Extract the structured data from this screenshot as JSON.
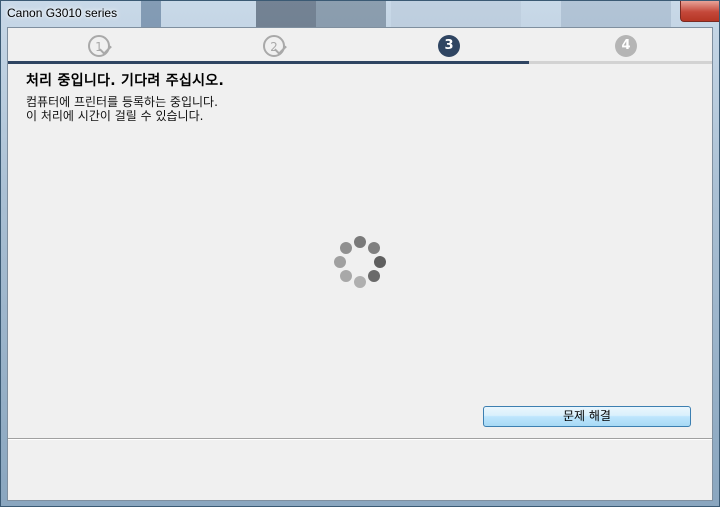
{
  "window": {
    "title": "Canon G3010 series"
  },
  "steps": [
    {
      "label": "1",
      "state": "done"
    },
    {
      "label": "2",
      "state": "done"
    },
    {
      "label": "3",
      "state": "current"
    },
    {
      "label": "4",
      "state": "future"
    }
  ],
  "progress": {
    "current_step": 3,
    "total_steps": 4
  },
  "main": {
    "heading": "처리 중입니다. 기다려 주십시오.",
    "description_line1": "컴퓨터에 프린터를 등록하는 중입니다.",
    "description_line2": "이 처리에 시간이 걸릴 수 있습니다."
  },
  "buttons": {
    "troubleshoot_label": "문제 해결"
  },
  "colors": {
    "accent": "#2f4562",
    "step_inactive": "#b5b5b5",
    "step_done": "#a9a9a9"
  },
  "icons": {
    "spinner": "loading-spinner-icon",
    "step_done_mark": "checkmark-icon"
  }
}
